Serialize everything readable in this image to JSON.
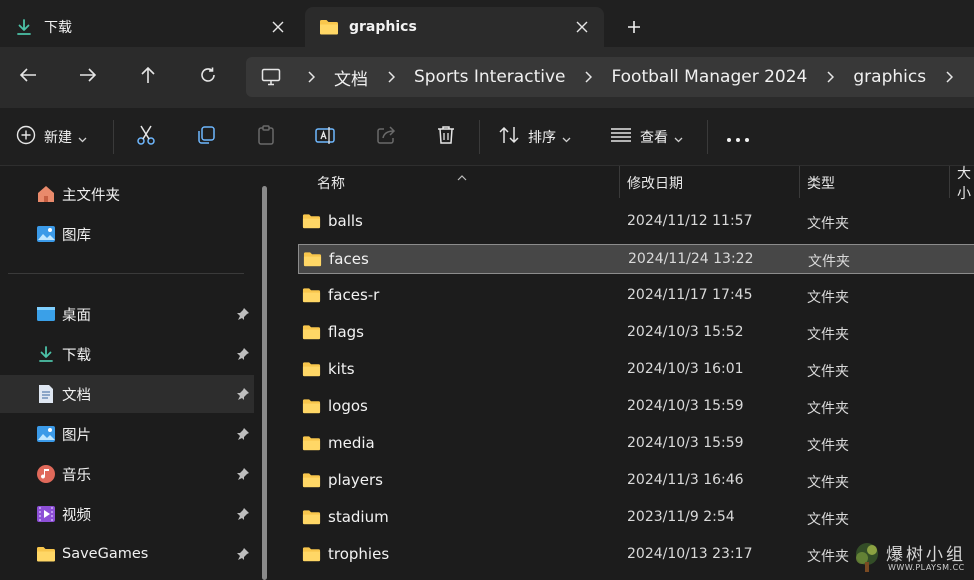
{
  "tabs": [
    {
      "label": "下载",
      "icon": "download-icon"
    },
    {
      "label": "graphics",
      "icon": "folder-icon"
    }
  ],
  "breadcrumb": [
    "文档",
    "Sports Interactive",
    "Football Manager 2024",
    "graphics"
  ],
  "toolbar": {
    "new_label": "新建",
    "sort_label": "排序",
    "view_label": "查看"
  },
  "sidebar": {
    "top_items": [
      {
        "label": "主文件夹",
        "icon": "home-icon"
      },
      {
        "label": "图库",
        "icon": "gallery-icon"
      }
    ],
    "pinned_items": [
      {
        "label": "桌面",
        "icon": "desktop-icon"
      },
      {
        "label": "下载",
        "icon": "download-icon"
      },
      {
        "label": "文档",
        "icon": "document-icon"
      },
      {
        "label": "图片",
        "icon": "pictures-icon"
      },
      {
        "label": "音乐",
        "icon": "music-icon"
      },
      {
        "label": "视频",
        "icon": "video-icon"
      },
      {
        "label": "SaveGames",
        "icon": "folder-icon"
      }
    ]
  },
  "columns": {
    "name": "名称",
    "modified": "修改日期",
    "type": "类型",
    "size": "大小"
  },
  "files": [
    {
      "name": "balls",
      "date": "2024/11/12 11:57",
      "type": "文件夹"
    },
    {
      "name": "faces",
      "date": "2024/11/24 13:22",
      "type": "文件夹"
    },
    {
      "name": "faces-r",
      "date": "2024/11/17 17:45",
      "type": "文件夹"
    },
    {
      "name": "flags",
      "date": "2024/10/3 15:52",
      "type": "文件夹"
    },
    {
      "name": "kits",
      "date": "2024/10/3 16:01",
      "type": "文件夹"
    },
    {
      "name": "logos",
      "date": "2024/10/3 15:59",
      "type": "文件夹"
    },
    {
      "name": "media",
      "date": "2024/10/3 15:59",
      "type": "文件夹"
    },
    {
      "name": "players",
      "date": "2024/11/3 16:46",
      "type": "文件夹"
    },
    {
      "name": "stadium",
      "date": "2023/11/9 2:54",
      "type": "文件夹"
    },
    {
      "name": "trophies",
      "date": "2024/10/13 23:17",
      "type": "文件夹"
    }
  ],
  "watermark": {
    "text": "爆树小组",
    "sub": "WWW.PLAYSM.CC"
  },
  "colors": {
    "accent": "#4cc2ff",
    "folder": "#f8c64c",
    "selected_row": "#474747",
    "background": "#1c1c1c"
  }
}
